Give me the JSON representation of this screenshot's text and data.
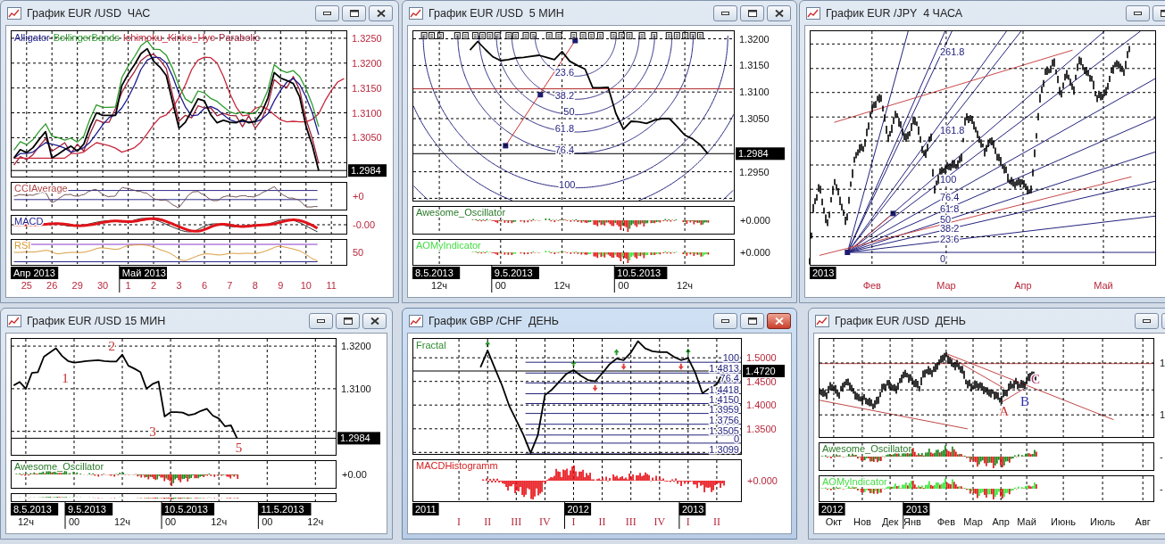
{
  "windows": [
    {
      "title": "График EUR /USD  ЧАС",
      "active": false,
      "kind": "indicators",
      "main": {
        "chart_data": {
          "type": "line",
          "grid": true,
          "categories": [
            null,
            null,
            null,
            null,
            null,
            null,
            null,
            null,
            null,
            null,
            null,
            null,
            null,
            null,
            null,
            null,
            null,
            null,
            null,
            null,
            null,
            null,
            null,
            null,
            null,
            null,
            null,
            null,
            null,
            null,
            null,
            null,
            null,
            null,
            null,
            null,
            null,
            null,
            null,
            null,
            null,
            null,
            null,
            null,
            null,
            null,
            null,
            null,
            null,
            null,
            null,
            null,
            null
          ],
          "series": [
            {
              "color": "#000000",
              "values": [
                1.3009,
                1.3026,
                1.302,
                1.303,
                1.3047,
                1.3062,
                1.3009,
                1.3017,
                1.3026,
                1.3033,
                1.3023,
                1.3037,
                1.3072,
                1.31,
                1.3095,
                1.3095,
                1.3095,
                1.3155,
                1.3178,
                1.3197,
                1.3219,
                1.3229,
                1.3204,
                1.3192,
                1.3175,
                1.3121,
                1.3069,
                1.3081,
                1.3104,
                1.3128,
                1.3124,
                1.3096,
                1.308,
                1.3085,
                1.3081,
                1.308,
                1.3086,
                1.308,
                1.3083,
                1.31,
                1.313,
                1.3181,
                1.317,
                1.3165,
                1.3159,
                1.3132,
                1.3073,
                1.3034,
                1.2984,
                null,
                null,
                null,
                null
              ]
            },
            {
              "name": "Alligator",
              "color": "#1c1c8c",
              "values": [
                1.3009,
                1.3018,
                1.3018,
                1.3021,
                1.3031,
                1.304,
                1.3037,
                1.3034,
                1.3029,
                1.3021,
                1.3025,
                1.303,
                1.3041,
                1.3058,
                1.3076,
                1.3091,
                1.3096,
                1.311,
                1.3131,
                1.3156,
                1.3187,
                1.3206,
                1.3212,
                1.3211,
                1.32,
                1.3173,
                1.3139,
                1.3112,
                1.3094,
                1.3096,
                1.3109,
                1.3113,
                1.3107,
                1.3096,
                1.3086,
                1.3082,
                1.3083,
                1.3082,
                1.3082,
                1.3087,
                1.3098,
                1.3124,
                1.3145,
                1.3162,
                1.3169,
                1.3157,
                1.3132,
                1.31,
                1.3056,
                null,
                null,
                null,
                null
              ]
            },
            {
              "name": "BollingerBands",
              "color": "#2e9a2e",
              "values": [
                1.3025,
                1.3042,
                1.3036,
                1.3046,
                1.3063,
                1.3078,
                1.3053,
                1.305,
                1.3045,
                1.3049,
                1.3041,
                1.3053,
                1.3088,
                1.3116,
                1.3111,
                1.3111,
                1.3112,
                1.3171,
                1.3194,
                1.3213,
                1.3235,
                1.3245,
                1.3228,
                1.3227,
                1.3216,
                1.3189,
                1.3155,
                1.3128,
                1.312,
                1.3144,
                1.314,
                1.3129,
                1.3123,
                1.3112,
                1.3102,
                1.3098,
                1.3102,
                1.3098,
                1.3099,
                1.3116,
                1.3146,
                1.3197,
                1.3186,
                1.3181,
                1.3185,
                1.3173,
                1.3148,
                1.3116,
                1.3072,
                null,
                null,
                null,
                null
              ]
            },
            {
              "name": "Ichimoku_Kinko_Hyo",
              "color": "#c8283c",
              "values": [
                1.3009,
                1.3009,
                1.3009,
                1.3009,
                1.3009,
                1.3009,
                1.3009,
                1.3009,
                1.3009,
                1.3018,
                1.3018,
                1.3021,
                1.3031,
                1.304,
                1.3037,
                1.3034,
                1.3029,
                1.3021,
                1.3025,
                1.303,
                1.3041,
                1.3058,
                1.3076,
                1.3091,
                1.3096,
                1.311,
                1.3131,
                1.3156,
                1.3187,
                1.3206,
                1.3212,
                1.3211,
                1.32,
                1.3173,
                1.3139,
                1.3112,
                1.3094,
                1.3096,
                1.3109,
                1.3113,
                1.3107,
                1.3096,
                1.3086,
                1.3082,
                1.3083,
                1.3082,
                1.3082,
                1.3087,
                1.3098,
                1.3124,
                1.3145,
                1.3162,
                1.3169
              ]
            },
            {
              "name": "Parabolic",
              "color": "#a0203a",
              "values": [
                1.2995,
                1.3012,
                1.3006,
                1.3016,
                1.3033,
                1.3048,
                1.3023,
                1.3031,
                1.304,
                1.3019,
                1.3037,
                1.3023,
                1.3058,
                1.3086,
                1.3081,
                1.3081,
                1.3109,
                1.3141,
                1.3164,
                1.3183,
                1.3205,
                1.3215,
                1.3218,
                1.3206,
                1.3189,
                1.3135,
                1.3083,
                1.3095,
                1.309,
                1.3114,
                1.311,
                1.311,
                1.3094,
                1.3099,
                1.3095,
                1.3094,
                1.3072,
                1.3094,
                1.3069,
                1.3086,
                1.3116,
                1.3167,
                1.3156,
                1.3151,
                1.3173,
                1.3146,
                1.3087,
                1.3048,
                1.2998,
                null,
                null,
                null,
                null
              ]
            }
          ],
          "ylim": [
            1.297,
            1.3266
          ],
          "yticks": [
            {
              "value": 1.325,
              "label": "1.3250"
            },
            {
              "value": 1.32,
              "label": "1.3200"
            },
            {
              "value": 1.315,
              "label": "1.3150"
            },
            {
              "value": 1.31,
              "label": "1.3100"
            },
            {
              "value": 1.305,
              "label": "1.3050"
            }
          ],
          "ref_lines": [
            {
              "axis": "y",
              "value": 1.2984,
              "label": "1.2984",
              "color": "#000000"
            }
          ]
        },
        "time_labels": [
          "25",
          "26",
          "29",
          "30",
          "1",
          "2",
          "3",
          "6",
          "7",
          "8",
          "9",
          "10",
          "11"
        ],
        "periods": [
          "Апр 2013",
          "Май 2013"
        ]
      },
      "panes": [
        {
          "kind": "cci",
          "title": "CCIAverage",
          "color": "#b04848",
          "zero_label": "+0"
        },
        {
          "kind": "macd",
          "title": "MACD",
          "color": "#1c1c8c",
          "zero_label": "-0.00"
        },
        {
          "kind": "rsi",
          "title": "RSI",
          "color": "#d8962e",
          "zero_label": "50"
        }
      ]
    },
    {
      "title": "График EUR /USD  5 МИН",
      "active": false,
      "kind": "fib_arcs",
      "main": {
        "chart_data": {
          "type": "line",
          "grid": true,
          "categories": [
            null,
            null,
            null,
            null,
            null,
            null,
            null,
            null,
            null,
            null,
            null,
            null,
            null,
            null,
            null,
            null,
            null,
            null,
            null,
            null,
            null,
            null,
            null,
            null,
            null,
            null,
            null,
            null,
            null,
            null,
            null,
            null,
            null,
            null,
            null,
            null,
            null,
            null,
            null,
            null,
            null,
            null
          ],
          "series": [
            {
              "color": "#000000",
              "values": [
                null,
                null,
                null,
                null,
                null,
                null,
                null,
                1.3179,
                1.3195,
                1.318,
                1.3166,
                1.3159,
                1.3161,
                1.3164,
                1.3165,
                1.3167,
                1.3169,
                1.3165,
                1.3161,
                1.3176,
                1.3158,
                1.315,
                1.3143,
                1.3108,
                1.3108,
                1.3109,
                1.306,
                1.303,
                1.3045,
                1.3044,
                1.3041,
                1.3047,
                1.305,
                1.305,
                1.3035,
                1.3019,
                1.3012,
                1.3001,
                1.2984,
                null,
                null,
                null
              ]
            }
          ],
          "ylim": [
            1.2894,
            1.3216
          ],
          "yticks": [
            {
              "value": 1.32,
              "label": "1.3200"
            },
            {
              "value": 1.315,
              "label": "1.3150"
            },
            {
              "value": 1.31,
              "label": "1.3100"
            },
            {
              "value": 1.305,
              "label": "1.3050"
            },
            {
              "value": 1.295,
              "label": "1.2950"
            }
          ],
          "ref_lines": [
            {
              "axis": "y",
              "value": 1.3106,
              "color": "#b02828"
            },
            {
              "axis": "y",
              "value": 1.2984,
              "label": "1.2984",
              "color": "#000000"
            }
          ]
        },
        "fib_labels": [
          "23.6",
          "38.2",
          "50",
          "61.8",
          "76.4",
          "100"
        ],
        "time_labels": [
          "12ч",
          "00",
          "12ч",
          "00",
          "12ч"
        ],
        "periods": [
          "8.5.2013",
          "9.5.2013",
          "10.5.2013"
        ]
      },
      "panes": [
        {
          "kind": "ao",
          "title": "Awesome_Oscillator",
          "color": "#2a7a2a",
          "zero_label": "+0.000"
        },
        {
          "kind": "aomy",
          "title": "AOMyIndicator",
          "color": "#44dd44",
          "zero_label": "+0.000"
        }
      ]
    },
    {
      "title": "График EUR /JPY  4 ЧАСА",
      "active": false,
      "kind": "fib_fan",
      "main": {
        "fib_labels": [
          "261.8",
          "161.8",
          "100",
          "76.4",
          "61.8",
          "50",
          "38.2",
          "23.6",
          "0"
        ],
        "time_labels": [
          "Фев",
          "Мар",
          "Апр",
          "Май"
        ],
        "periods": [
          "2013"
        ]
      }
    },
    {
      "title": "График EUR /USD 15 МИН",
      "active": false,
      "kind": "elliott",
      "main": {
        "chart_data": {
          "type": "line",
          "grid": true,
          "categories": [
            null,
            null,
            null,
            null,
            null,
            null,
            null,
            null,
            null,
            null,
            null,
            null,
            null,
            null,
            null,
            null,
            null,
            null,
            null,
            null,
            null,
            null,
            null,
            null,
            null,
            null,
            null,
            null,
            null,
            null,
            null,
            null,
            null,
            null,
            null,
            null,
            null,
            null,
            null,
            null,
            null,
            null,
            null,
            null,
            null,
            null,
            null,
            null,
            null,
            null,
            null,
            null,
            null,
            null
          ],
          "series": [
            {
              "color": "#000000",
              "values": [
                1.3108,
                1.3116,
                1.31,
                1.3137,
                1.3139,
                1.3175,
                1.3185,
                1.3195,
                1.3177,
                1.3165,
                1.3161,
                1.3163,
                1.3165,
                1.3166,
                1.3167,
                1.3165,
                1.3164,
                1.3164,
                1.318,
                1.3154,
                1.3147,
                1.3139,
                1.31,
                1.3111,
                1.3117,
                1.3035,
                1.3045,
                1.3045,
                1.3044,
                1.3038,
                1.3041,
                1.3048,
                1.3053,
                1.3037,
                1.303,
                1.3012,
                1.3014,
                1.2984,
                null,
                null,
                null,
                null,
                null,
                null,
                null,
                null,
                null,
                null,
                null,
                null,
                null,
                null,
                null,
                null
              ]
            }
          ],
          "ylim": [
            1.2943,
            1.3219
          ],
          "yticks": [
            {
              "value": 1.32,
              "label": "1.3200"
            },
            {
              "value": 1.31,
              "label": "1.3100"
            }
          ],
          "ref_lines": [
            {
              "axis": "y",
              "value": 1.2984,
              "label": "1.2984",
              "color": "#000000"
            }
          ]
        },
        "wave_labels": [
          {
            "text": "1"
          },
          {
            "text": "2"
          },
          {
            "text": "3"
          },
          {
            "text": "5"
          }
        ],
        "time_labels": [
          "12ч",
          "00",
          "12ч",
          "00",
          "12ч",
          "00",
          "12ч"
        ],
        "periods": [
          "8.5.2013",
          "9.5.2013",
          "10.5.2013",
          "11.5.2013"
        ]
      },
      "panes": [
        {
          "kind": "ao",
          "title": "Awesome_Oscillator",
          "color": "#2a7a2a",
          "zero_label": "+0.00"
        },
        {
          "kind": "hist"
        }
      ]
    },
    {
      "title": "График GBP /CHF  ДЕНЬ",
      "active": true,
      "kind": "fib_levels",
      "main": {
        "legend": [
          {
            "text": "Fractal",
            "color": "#2e8b2e"
          }
        ],
        "chart_data": {
          "type": "line",
          "grid": true,
          "categories": [
            null,
            null,
            null,
            null,
            null,
            null,
            null,
            null,
            null,
            null,
            null,
            null,
            null,
            null,
            null,
            null,
            null,
            null,
            null,
            null,
            null,
            null,
            null,
            null,
            null,
            null,
            null,
            null,
            null,
            null,
            null,
            null,
            null,
            null,
            null,
            null,
            null,
            null,
            null,
            null,
            null,
            null,
            null,
            null,
            null,
            null
          ],
          "series": [
            {
              "color": "#000000",
              "values": [
                null,
                null,
                null,
                null,
                null,
                null,
                null,
                null,
                null,
                1.48,
                1.515,
                1.478,
                1.442,
                1.399,
                1.368,
                1.337,
                1.299,
                1.336,
                1.421,
                1.433,
                1.449,
                1.466,
                1.474,
                1.462,
                1.453,
                1.45,
                1.467,
                1.486,
                1.498,
                1.495,
                1.511,
                1.535,
                1.52,
                1.514,
                1.512,
                1.512,
                1.502,
                1.495,
                1.499,
                1.468,
                1.425,
                1.436,
                1.444,
                1.472,
                null,
                null
              ]
            }
          ],
          "ylim": [
            1.2949,
            1.5418
          ],
          "yticks": [
            {
              "value": 1.5,
              "label": "1.5000"
            },
            {
              "value": 1.45,
              "label": "1.4500"
            },
            {
              "value": 1.4,
              "label": "1.4000"
            },
            {
              "value": 1.35,
              "label": "1.3500"
            }
          ],
          "ref_lines": [
            {
              "axis": "y",
              "value": 1.472,
              "label": "1.4720",
              "color": "#000000"
            }
          ]
        },
        "fib_labels": [
          "100",
          "1.4813",
          "76.4",
          "1.4418",
          "1.4150",
          "1.3959",
          "1.3756",
          "1.3505",
          "0",
          "1.3099"
        ],
        "time_labels": [
          "I",
          "II",
          "III",
          "IV",
          "I",
          "II",
          "III",
          "IV",
          "I",
          "II"
        ],
        "periods": [
          "2011",
          "2012",
          "2013"
        ]
      },
      "panes": [
        {
          "kind": "macd_hist",
          "title": "MACDHistogramm",
          "color": "#d42020",
          "zero_label": "+0.000"
        }
      ]
    },
    {
      "title": "График EUR /USD  ДЕНЬ",
      "active": false,
      "kind": "abc",
      "main": {
        "wave_labels": [
          {
            "text": "A",
            "color": "#c83838"
          },
          {
            "text": "B",
            "color": "#2a2aa8"
          },
          {
            "text": "C",
            "color": "#b0306a"
          }
        ],
        "axis_labels": [
          "1",
          "1"
        ],
        "time_labels": [
          "Окт",
          "Нов",
          "Дек",
          "Янв",
          "Фев",
          "Мар",
          "Апр",
          "Май",
          "Июнь",
          "Июль",
          "Авг"
        ],
        "periods": [
          "2012",
          "2013"
        ]
      },
      "panes": [
        {
          "kind": "ao",
          "title": "Awesome_Oscillator",
          "color": "#2a7a2a",
          "zero_label": "-"
        },
        {
          "kind": "aomy",
          "title": "AOMyIndicator",
          "color": "#44dd44",
          "zero_label": "-"
        }
      ]
    }
  ]
}
